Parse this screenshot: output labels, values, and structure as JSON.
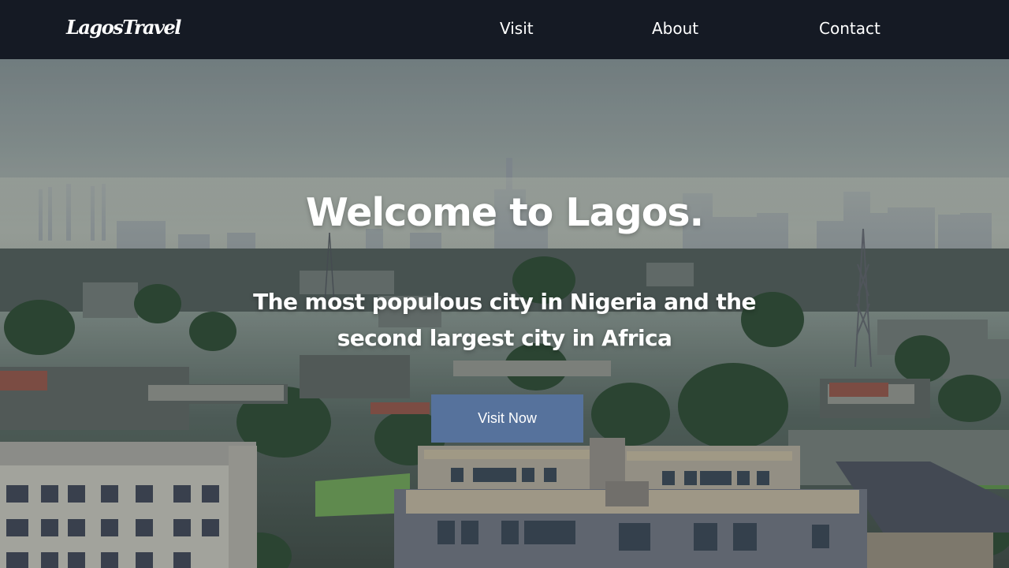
{
  "header": {
    "logo_text": "LagosTravel",
    "nav": {
      "visit": "Visit",
      "about": "About",
      "contact": "Contact"
    }
  },
  "hero": {
    "title": "Welcome to Lagos.",
    "subtitle": "The most populous city in Nigeria and the second largest city in Africa",
    "cta_label": "Visit Now",
    "background_image": "lagos-city-skyline-photo"
  },
  "colors": {
    "navbar_bg": "#151a24",
    "button_bg": "#56729c",
    "text": "#ffffff"
  }
}
